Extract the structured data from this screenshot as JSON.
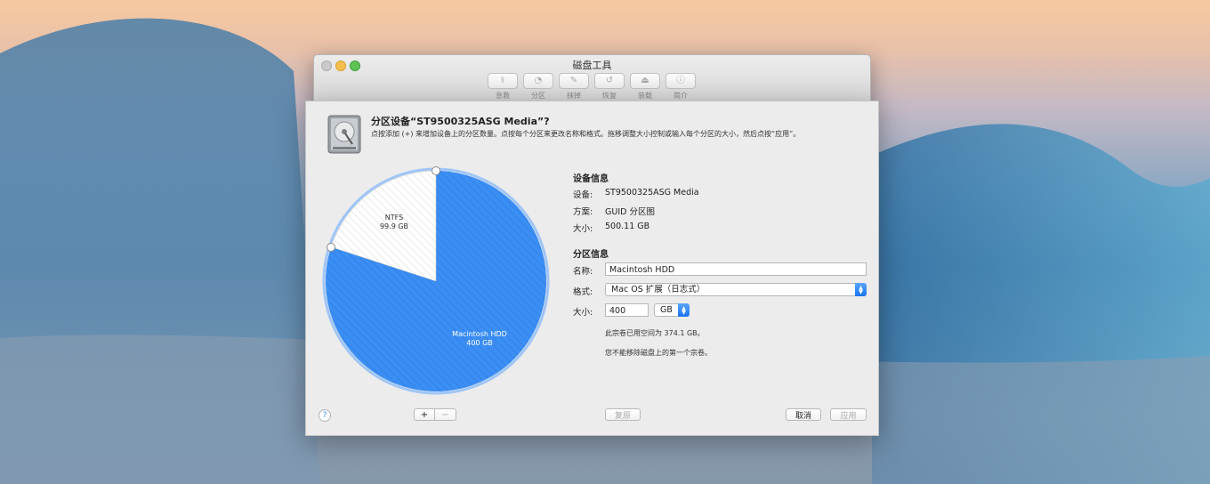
{
  "window": {
    "title": "磁盘工具"
  },
  "toolbar": [
    {
      "label": "急救",
      "icon": "stethoscope-icon",
      "glyph": "⚕"
    },
    {
      "label": "分区",
      "icon": "partition-icon",
      "glyph": "◔"
    },
    {
      "label": "抹掉",
      "icon": "erase-icon",
      "glyph": "✎"
    },
    {
      "label": "恢复",
      "icon": "restore-icon",
      "glyph": "↺"
    },
    {
      "label": "装载",
      "icon": "mount-icon",
      "glyph": "⏏"
    },
    {
      "label": "简介",
      "icon": "info-icon",
      "glyph": "ⓘ"
    }
  ],
  "sheet": {
    "title": "分区设备“ST9500325ASG Media”?",
    "description": "点按添加 (+) 来增加设备上的分区数量。点按每个分区来更改名称和格式。拖移调整大小控制或输入每个分区的大小，然后点按“应用”。"
  },
  "pie": {
    "partitions": [
      {
        "name": "NTFS",
        "size": "99.9 GB",
        "gb": 99.9,
        "color": "#ffffff"
      },
      {
        "name": "Macintosh HDD",
        "size": "400 GB",
        "gb": 400,
        "color": "#3a8ef4"
      }
    ]
  },
  "device_info": {
    "title": "设备信息",
    "rows": [
      {
        "key": "设备:",
        "value": "ST9500325ASG Media"
      },
      {
        "key": "方案:",
        "value": "GUID 分区图"
      },
      {
        "key": "大小:",
        "value": "500.11 GB"
      }
    ]
  },
  "partition_info": {
    "title": "分区信息",
    "name_label": "名称:",
    "name_value": "Macintosh HDD",
    "format_label": "格式:",
    "format_value": "Mac OS 扩展（日志式）",
    "size_label": "大小:",
    "size_value": "400",
    "unit_value": "GB",
    "note1": "此宗卷已用空间为 374.1 GB。",
    "note2": "您不能移除磁盘上的第一个宗卷。"
  },
  "buttons": {
    "help": "?",
    "add": "+",
    "remove": "−",
    "revert": "复原",
    "cancel": "取消",
    "apply": "应用"
  },
  "colors": {
    "accent": "#3a8ef4",
    "sheet_bg": "#ececec"
  }
}
